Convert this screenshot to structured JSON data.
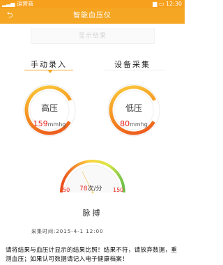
{
  "status_bar": {
    "carrier": "运营商",
    "time": "12:30"
  },
  "app_bar": {
    "back_icon": "back-arrow-icon",
    "title": "智能血压仪"
  },
  "result_box": {
    "label": "显示结果"
  },
  "tabs": [
    {
      "label": "手动录入",
      "active": true
    },
    {
      "label": "设备采集",
      "active": false
    }
  ],
  "high_pressure": {
    "label": "高压",
    "value": "159",
    "unit": "mmhg"
  },
  "low_pressure": {
    "label": "低压",
    "value": "80",
    "unit": "mmhg"
  },
  "pulse": {
    "label": "脉搏",
    "value": "78",
    "unit": "次/分",
    "min": "50",
    "max": "150"
  },
  "capture_time": "采集时间:2015-4-1    12:00",
  "footer_text": "请将结果与血压计显示的结果比照！结果不符，请放弃数据，重测血压；如果认可数据请记入电子健康档案！",
  "colors": {
    "accent": "#f5a623",
    "value_red": "#e8231a",
    "gauge_green": "#7cc242"
  }
}
